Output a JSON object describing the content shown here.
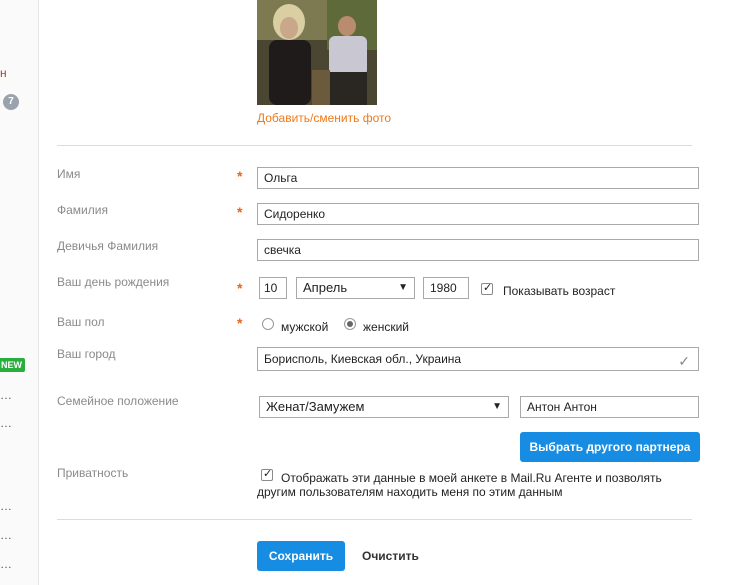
{
  "sidebar": {
    "h_fragment": "н",
    "badge": "7",
    "new_badge": "NEW",
    "dots": "…"
  },
  "photo": {
    "link_label": "Добавить/сменить фото"
  },
  "form": {
    "first_name": {
      "label": "Имя",
      "value": "Ольга",
      "required": "*"
    },
    "last_name": {
      "label": "Фамилия",
      "value": "Сидоренко",
      "required": "*"
    },
    "maiden_name": {
      "label": "Девичья Фамилия",
      "value": "свечка"
    },
    "birthday": {
      "label": "Ваш день рождения",
      "required": "*",
      "day": "10",
      "month": "Апрель",
      "year": "1980",
      "show_age_label": "Показывать возраст",
      "show_age_checked": true
    },
    "gender": {
      "label": "Ваш пол",
      "required": "*",
      "male": "мужской",
      "female": "женский",
      "selected": "female"
    },
    "city": {
      "label": "Ваш город",
      "value": "Борисполь, Киевская обл., Украина"
    },
    "marital": {
      "label": "Семейное положение",
      "value": "Женат/Замужем",
      "partner": "Антон Антон",
      "choose_partner_label": "Выбрать другого партнера"
    },
    "privacy": {
      "label": "Приватность",
      "text_line1": "Отображать эти данные в моей анкете в Mail.Ru Агенте и позволять",
      "text_line2": "другим пользователям находить меня по этим данным",
      "checked": true
    }
  },
  "actions": {
    "save_label": "Сохранить",
    "clear_label": "Очистить"
  },
  "icons": {
    "dropdown": "▼",
    "check": "✓"
  },
  "colors": {
    "accent_orange": "#f07a1a",
    "primary_blue": "#168de2",
    "new_green": "#27ae3c"
  }
}
